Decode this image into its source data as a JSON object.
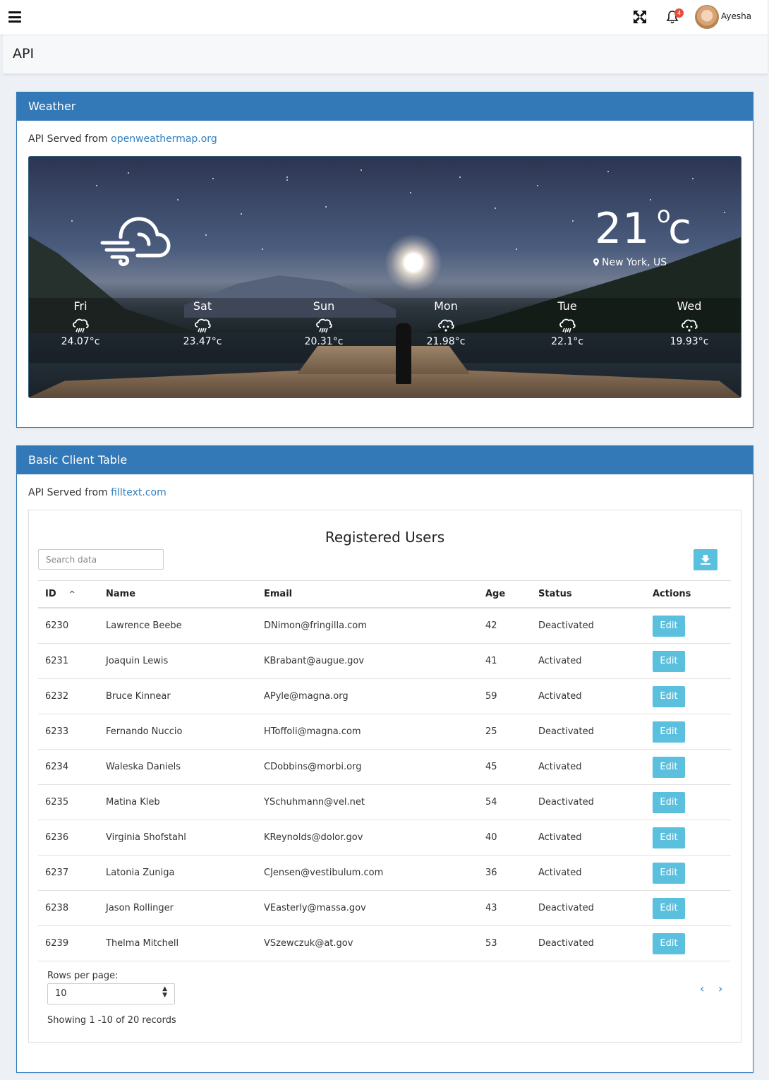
{
  "topbar": {
    "notifications": "4",
    "username": "Ayesha"
  },
  "page": {
    "title": "API"
  },
  "weather": {
    "panel_title": "Weather",
    "served_prefix": "API Served from",
    "served_link": "openweathermap.org",
    "current_temp": "21",
    "degree_symbol": "o",
    "unit": "c",
    "location": "New York, US",
    "current_icon": "cloud-wind-icon",
    "forecast": [
      {
        "day": "Fri",
        "icon": "rain-icon",
        "temp": "24.07°c"
      },
      {
        "day": "Sat",
        "icon": "rain-icon",
        "temp": "23.47°c"
      },
      {
        "day": "Sun",
        "icon": "rain-icon",
        "temp": "20.31°c"
      },
      {
        "day": "Mon",
        "icon": "light-rain-icon",
        "temp": "21.98°c"
      },
      {
        "day": "Tue",
        "icon": "rain-icon",
        "temp": "22.1°c"
      },
      {
        "day": "Wed",
        "icon": "light-rain-icon",
        "temp": "19.93°c"
      }
    ]
  },
  "clients": {
    "panel_title": "Basic Client Table",
    "served_prefix": "API Served from",
    "served_link": "filltext.com",
    "table_title": "Registered Users",
    "search_placeholder": "Search data",
    "columns": [
      "ID",
      "Name",
      "Email",
      "Age",
      "Status",
      "Actions"
    ],
    "sort_indicator": "^",
    "edit_label": "Edit",
    "rows": [
      {
        "id": "6230",
        "name": "Lawrence Beebe",
        "email": "DNimon@fringilla.com",
        "age": "42",
        "status": "Deactivated"
      },
      {
        "id": "6231",
        "name": "Joaquin Lewis",
        "email": "KBrabant@augue.gov",
        "age": "41",
        "status": "Activated"
      },
      {
        "id": "6232",
        "name": "Bruce Kinnear",
        "email": "APyle@magna.org",
        "age": "59",
        "status": "Activated"
      },
      {
        "id": "6233",
        "name": "Fernando Nuccio",
        "email": "HToffoli@magna.com",
        "age": "25",
        "status": "Deactivated"
      },
      {
        "id": "6234",
        "name": "Waleska Daniels",
        "email": "CDobbins@morbi.org",
        "age": "45",
        "status": "Activated"
      },
      {
        "id": "6235",
        "name": "Matina Kleb",
        "email": "YSchuhmann@vel.net",
        "age": "54",
        "status": "Deactivated"
      },
      {
        "id": "6236",
        "name": "Virginia Shofstahl",
        "email": "KReynolds@dolor.gov",
        "age": "40",
        "status": "Activated"
      },
      {
        "id": "6237",
        "name": "Latonia Zuniga",
        "email": "CJensen@vestibulum.com",
        "age": "36",
        "status": "Activated"
      },
      {
        "id": "6238",
        "name": "Jason Rollinger",
        "email": "VEasterly@massa.gov",
        "age": "43",
        "status": "Deactivated"
      },
      {
        "id": "6239",
        "name": "Thelma Mitchell",
        "email": "VSzewczuk@at.gov",
        "age": "53",
        "status": "Deactivated"
      }
    ],
    "rows_per_page_label": "Rows per page:",
    "rows_per_page_value": "10",
    "prev_label": "‹",
    "next_label": "›",
    "showing": "Showing 1 -10 of 20 records"
  },
  "colors": {
    "primary": "#3378b7",
    "info": "#5bc0de",
    "link": "#2f7fc1",
    "badge": "#e74c3c"
  }
}
